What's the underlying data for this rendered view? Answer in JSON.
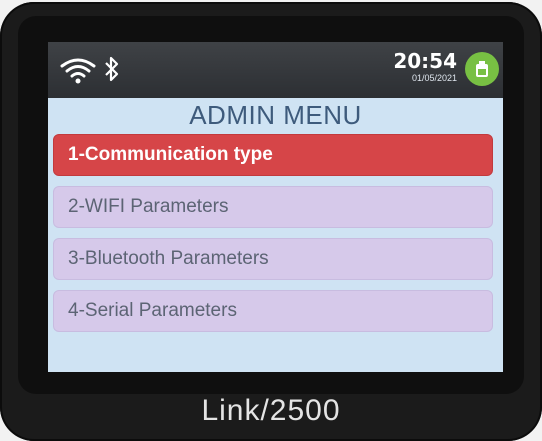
{
  "status": {
    "time": "20:54",
    "date": "01/05/2021",
    "wifi_icon": "wifi-icon",
    "bluetooth_icon": "bluetooth-icon",
    "battery_icon": "battery-icon",
    "battery_color": "#78c043"
  },
  "menu": {
    "title": "ADMIN MENU",
    "selected_color": "#d64548",
    "item_color": "#d6c9ea",
    "items": [
      {
        "label": "1-Communication type",
        "selected": true
      },
      {
        "label": "2-WIFI Parameters",
        "selected": false
      },
      {
        "label": "3-Bluetooth Parameters",
        "selected": false
      },
      {
        "label": "4-Serial Parameters",
        "selected": false
      }
    ]
  },
  "device": {
    "brand": "Link/2500"
  }
}
